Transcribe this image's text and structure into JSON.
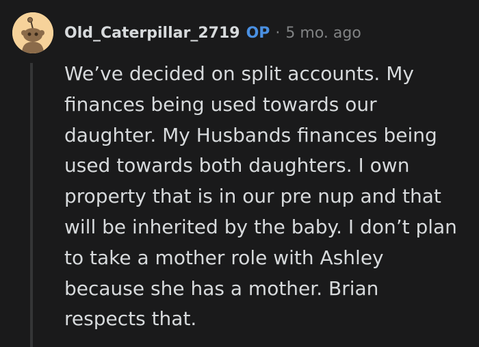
{
  "comment": {
    "author": "Old_Caterpillar_2719",
    "op_badge": "OP",
    "separator": "·",
    "timestamp": "5 mo. ago",
    "avatar_icon": "snoo-avatar-icon",
    "avatar_color": "#f6d29a",
    "body_lines": [
      "We’ve decided on split accounts. My",
      "finances being used towards our",
      "daughter. My Husbands finances being",
      "used towards both daughters. I own",
      "property that is in our pre nup and that",
      "will be inherited by the baby. I don’t plan",
      "to take a mother role with Ashley",
      "because she has a mother. Brian",
      "respects that."
    ]
  },
  "colors": {
    "background": "#1a1a1b",
    "text": "#d7dadc",
    "meta": "#818384",
    "op": "#4a90e2",
    "thread_line": "#343536"
  }
}
